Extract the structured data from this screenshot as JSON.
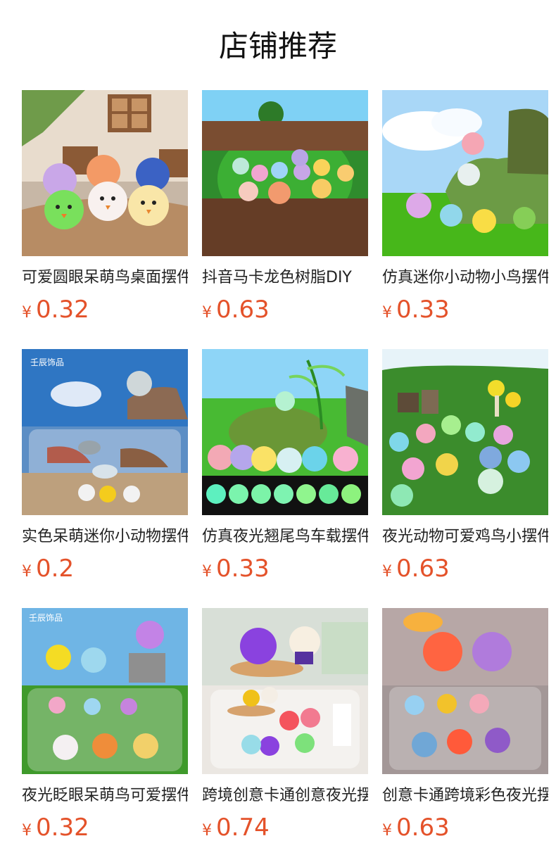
{
  "page": {
    "title": "店铺推荐"
  },
  "products": [
    {
      "title": "可爱圆眼呆萌鸟桌面摆件",
      "currency": "¥",
      "price": "0.32",
      "image": "cute-birds-house-scene"
    },
    {
      "title": "抖音马卡龙色树脂DIY",
      "currency": "¥",
      "price": "0.63",
      "image": "birds-in-fenced-garden"
    },
    {
      "title": "仿真迷你小动物小鸟摆件",
      "currency": "¥",
      "price": "0.33",
      "image": "parrots-on-mossy-rock"
    },
    {
      "title": "实色呆萌迷你小动物摆件",
      "currency": "¥",
      "price": "0.2",
      "image": "seal-dolphin-beach"
    },
    {
      "title": "仿真夜光翘尾鸟车载摆件",
      "currency": "¥",
      "price": "0.33",
      "image": "glowing-tail-birds"
    },
    {
      "title": "夜光动物可爱鸡鸟小摆件",
      "currency": "¥",
      "price": "0.63",
      "image": "glowing-chicks-on-grass"
    },
    {
      "title": "夜光眨眼呆萌鸟可爱摆件",
      "currency": "¥",
      "price": "0.32",
      "image": "winking-birds-on-grass"
    },
    {
      "title": "跨境创意卡通创意夜光摆件",
      "currency": "¥",
      "price": "0.74",
      "image": "purple-birds-dollhouse"
    },
    {
      "title": "创意卡通跨境彩色夜光摆件",
      "currency": "¥",
      "price": "0.63",
      "image": "colorful-translucent-birds"
    }
  ],
  "watermark": "壬辰饰品"
}
